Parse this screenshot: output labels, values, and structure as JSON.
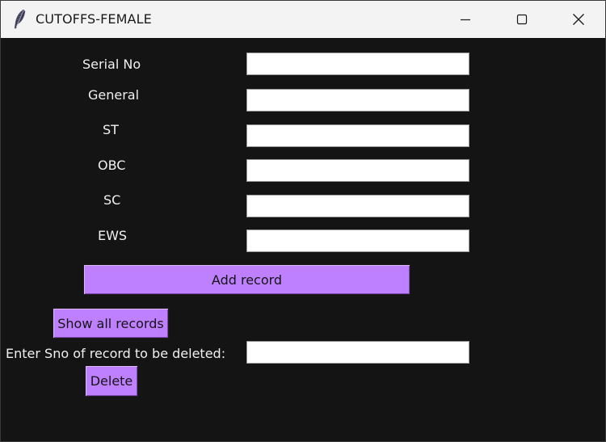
{
  "window": {
    "title": "CUTOFFS-FEMALE",
    "icon": "feather-icon"
  },
  "form": {
    "fields": [
      {
        "label": "Serial No",
        "value": ""
      },
      {
        "label": "General",
        "value": ""
      },
      {
        "label": "ST",
        "value": ""
      },
      {
        "label": "OBC",
        "value": ""
      },
      {
        "label": "SC",
        "value": ""
      },
      {
        "label": "EWS",
        "value": ""
      }
    ],
    "add_label": "Add record",
    "show_all_label": "Show all records",
    "delete_prompt": "Enter Sno of record to be deleted:",
    "delete_value": "",
    "delete_label": "Delete"
  },
  "colors": {
    "background": "#141414",
    "button": "#bf80ff",
    "titlebar": "#f3f3f3"
  }
}
